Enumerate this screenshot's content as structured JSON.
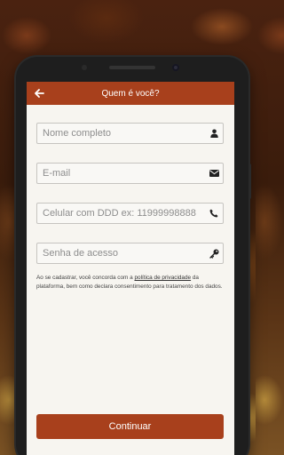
{
  "header": {
    "title": "Quem é você?"
  },
  "form": {
    "name": {
      "placeholder": "Nome completo",
      "icon": "user-icon"
    },
    "email": {
      "placeholder": "E-mail",
      "icon": "envelope-icon"
    },
    "phone": {
      "placeholder": "Celular com DDD ex: 11999998888",
      "icon": "phone-icon"
    },
    "password": {
      "placeholder": "Senha de acesso",
      "icon": "key-icon"
    }
  },
  "terms": {
    "before": "Ao se cadastrar, você concorda com a ",
    "link": "política de privacidade",
    "after": " da plataforma, bem como declara consentimento para tratamento dos dados."
  },
  "actions": {
    "continue_label": "Continuar"
  },
  "colors": {
    "accent": "#a8401c",
    "screen_background": "#f7f5f0"
  }
}
